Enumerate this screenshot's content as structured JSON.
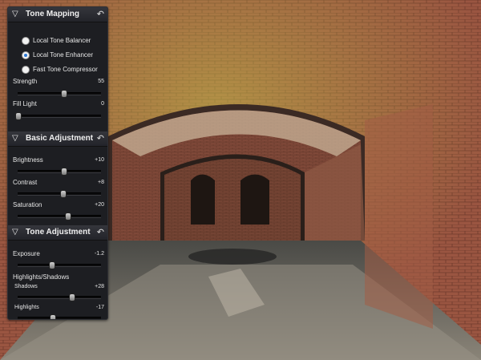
{
  "tone_mapping": {
    "title": "Tone Mapping",
    "options": [
      {
        "label": "Local Tone Balancer",
        "selected": false
      },
      {
        "label": "Local Tone Enhancer",
        "selected": true
      },
      {
        "label": "Fast Tone Compressor",
        "selected": false
      }
    ],
    "sliders": [
      {
        "label": "Strength",
        "value": "55",
        "fraction": 0.55
      },
      {
        "label": "Fill Light",
        "value": "0",
        "fraction": 0.0
      }
    ]
  },
  "basic_adjustment": {
    "title": "Basic Adjustment",
    "sliders": [
      {
        "label": "Brightness",
        "value": "+10",
        "fraction": 0.55
      },
      {
        "label": "Contrast",
        "value": "+8",
        "fraction": 0.54
      },
      {
        "label": "Saturation",
        "value": "+20",
        "fraction": 0.6
      }
    ]
  },
  "tone_adjustment": {
    "title": "Tone Adjustment",
    "sliders": [
      {
        "label": "Exposure",
        "value": "-1.2",
        "fraction": 0.4
      },
      {
        "label": "Highlights/Shadows",
        "value": "",
        "fraction": null
      },
      {
        "label": "Shadows",
        "value": "+28",
        "fraction": 0.64
      },
      {
        "label": "Highlights",
        "value": "-17",
        "fraction": 0.41
      }
    ]
  },
  "colors": {
    "panel": "#1d1e22",
    "accent": "#2d7ad6"
  }
}
